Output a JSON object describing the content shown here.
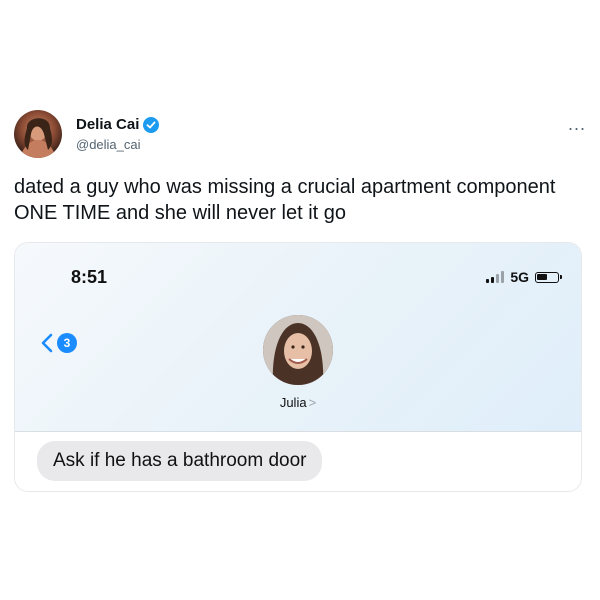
{
  "tweet": {
    "author_name": "Delia Cai",
    "handle": "@delia_cai",
    "more_label": "...",
    "text": "dated a guy who was missing a crucial apartment component ONE TIME and she will never let it go"
  },
  "phone_screenshot": {
    "status_bar": {
      "time": "8:51",
      "network": "5G"
    },
    "header": {
      "back_badge_count": "3",
      "contact_name": "Julia",
      "contact_chevron": ">"
    },
    "messages": [
      {
        "text": "Ask if he has a bathroom door",
        "sender": "them"
      }
    ]
  },
  "colors": {
    "verified": "#1d9bf0",
    "ios_blue": "#1a8cff",
    "bubble_gray": "#e9e9eb"
  }
}
